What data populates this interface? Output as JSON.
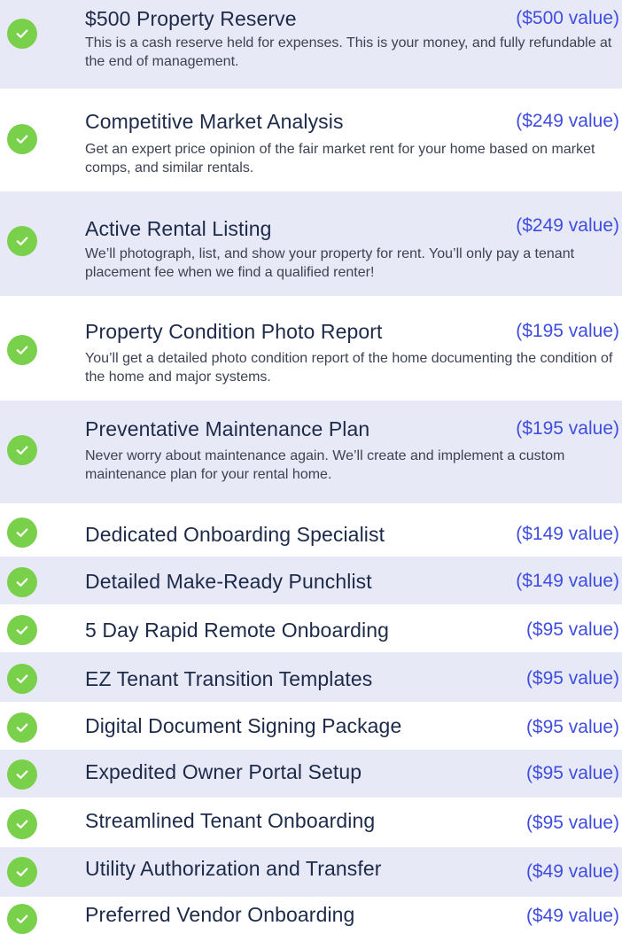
{
  "items": [
    {
      "title": "$500 Property Reserve",
      "value": "($500 value)",
      "description": "This is a cash reserve held for expenses. This is your money, and fully refundable at the end of management."
    },
    {
      "title": "Competitive Market Analysis",
      "value": "($249 value)",
      "description": "Get an expert price opinion of the fair market rent for your home based on market comps, and similar rentals."
    },
    {
      "title": "Active Rental Listing",
      "value": "($249 value)",
      "description": "We’ll photograph,  list, and show your property for rent. You’ll only pay a tenant placement fee when we find a qualified renter!"
    },
    {
      "title": "Property Condition Photo Report",
      "value": "($195 value)",
      "description": "You’ll get a detailed photo condition report of the home documenting the condition of the home and major systems."
    },
    {
      "title": "Preventative Maintenance Plan",
      "value": "($195 value)",
      "description": "Never worry about maintenance again. We’ll create and implement a custom maintenance plan for your rental home."
    },
    {
      "title": "Dedicated Onboarding Specialist",
      "value": "($149 value)"
    },
    {
      "title": "Detailed Make-Ready Punchlist",
      "value": "($149 value)"
    },
    {
      "title": "5 Day Rapid Remote Onboarding",
      "value": "($95 value)"
    },
    {
      "title": "EZ Tenant Transition Templates",
      "value": "($95 value)"
    },
    {
      "title": "Digital Document Signing Package",
      "value": "($95 value)"
    },
    {
      "title": "Expedited Owner Portal Setup",
      "value": "($95 value)"
    },
    {
      "title": "Streamlined Tenant Onboarding",
      "value": "($95 value)"
    },
    {
      "title": "Utility Authorization and Transfer",
      "value": "($49 value)"
    },
    {
      "title": "Preferred Vendor Onboarding",
      "value": "($49 value)"
    }
  ],
  "colors": {
    "check_fill": "#79d04a",
    "value_text": "#3f4de0",
    "title_text": "#1d2a4a",
    "row_tint": "#e8e9f6"
  },
  "icons": {
    "row_marker": "check-circle-icon"
  }
}
